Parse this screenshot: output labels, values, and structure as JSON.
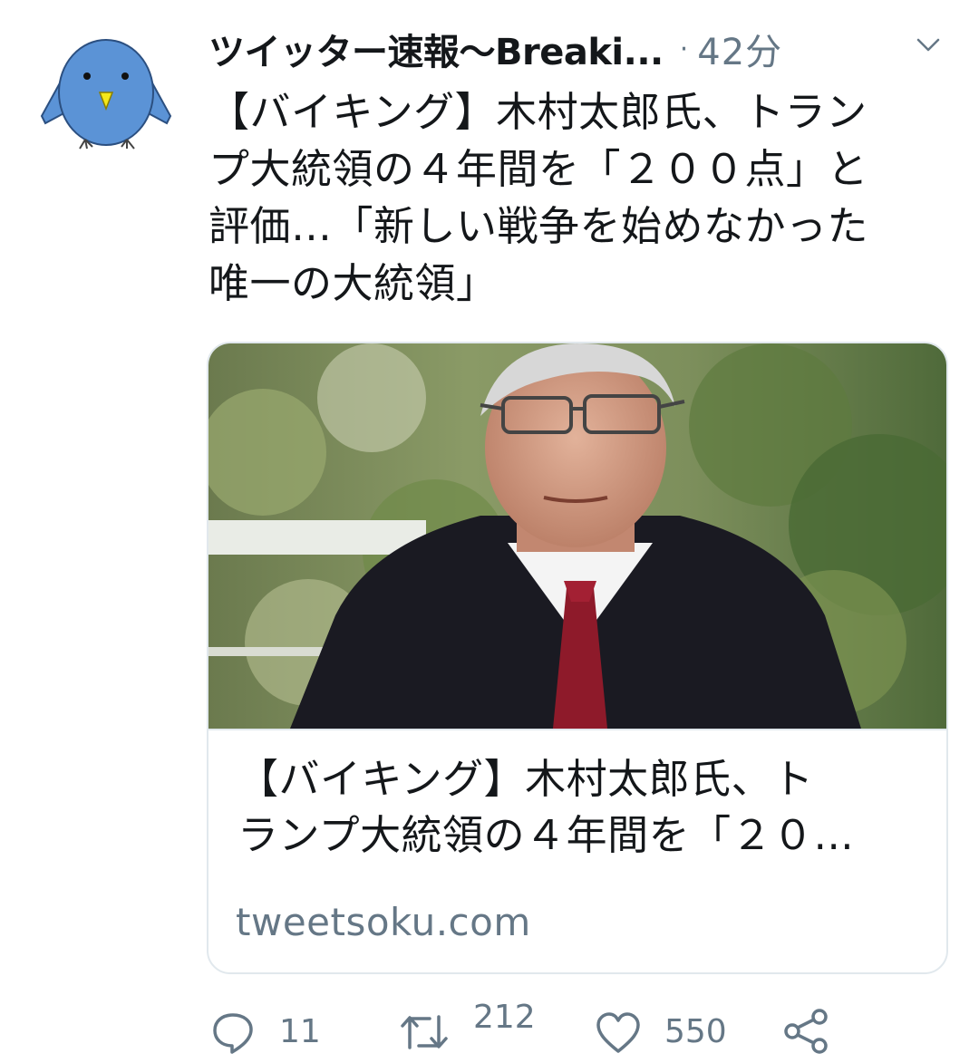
{
  "tweet": {
    "author_name": "ツイッター速報〜Breaki...",
    "separator": "·",
    "time": "42分",
    "text_lines": [
      "【バイキング】木村太郎氏、トラン",
      "プ大統領の４年間を「２００点」と",
      "評価…「新しい戦争を始めなかった",
      "唯一の大統領」"
    ]
  },
  "card": {
    "title_lines": [
      "【バイキング】木村太郎氏、ト",
      "ランプ大統領の４年間を「２０..."
    ],
    "domain": "tweetsoku.com"
  },
  "actions": {
    "reply_count": "11",
    "retweet_count": "212",
    "like_count": "550"
  },
  "icons": {
    "avatar": "bird-avatar",
    "caret": "chevron-down-icon",
    "reply": "reply-icon",
    "retweet": "retweet-icon",
    "like": "heart-icon",
    "share": "share-icon"
  },
  "colors": {
    "text": "#14171a",
    "secondary": "#657786",
    "border": "#e1e8ed",
    "avatar_blue": "#5b93d6",
    "beak": "#f4e81a"
  }
}
